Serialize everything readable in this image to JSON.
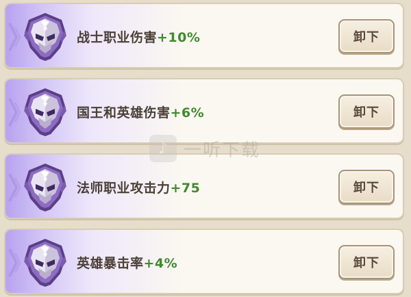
{
  "perks": [
    {
      "name": "战士职业伤害",
      "bonus": "+10%",
      "button_label": "卸下",
      "icon": "purple-helmet-emblem-icon"
    },
    {
      "name": "国王和英雄伤害",
      "bonus": "+6%",
      "button_label": "卸下",
      "icon": "purple-helmet-emblem-icon"
    },
    {
      "name": "法师职业攻击力",
      "bonus": "+75",
      "button_label": "卸下",
      "icon": "purple-helmet-emblem-icon"
    },
    {
      "name": "英雄暴击率",
      "bonus": "+4%",
      "button_label": "卸下",
      "icon": "purple-helmet-emblem-icon"
    }
  ],
  "watermark": {
    "text": "一听下载"
  },
  "colors": {
    "bonus": "#3f8a2e",
    "rarity": "#b7a2f0",
    "card": "#fbf8f1",
    "background": "#e6ddcb"
  }
}
